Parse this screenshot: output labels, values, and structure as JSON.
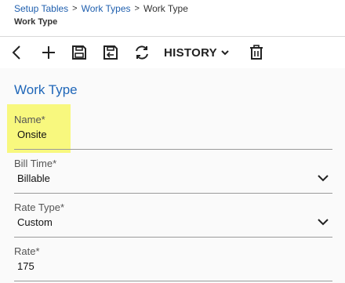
{
  "breadcrumb": {
    "items": [
      "Setup Tables",
      "Work Types"
    ],
    "current": "Work Type"
  },
  "page": {
    "title": "Work Type"
  },
  "toolbar": {
    "history_label": "HISTORY",
    "icons": [
      "back-icon",
      "add-icon",
      "save-icon",
      "save-close-icon",
      "refresh-icon",
      "chevron-down-icon",
      "delete-icon"
    ]
  },
  "form": {
    "section_title": "Work Type",
    "fields": [
      {
        "label": "Name*",
        "value": "Onsite",
        "type": "text",
        "highlighted": true
      },
      {
        "label": "Bill Time*",
        "value": "Billable",
        "type": "select"
      },
      {
        "label": "Rate Type*",
        "value": "Custom",
        "type": "select"
      },
      {
        "label": "Rate*",
        "value": "175",
        "type": "text"
      }
    ]
  },
  "colors": {
    "accent": "#1f66b8",
    "link": "#1f5fae",
    "highlight": "#f7f767"
  }
}
